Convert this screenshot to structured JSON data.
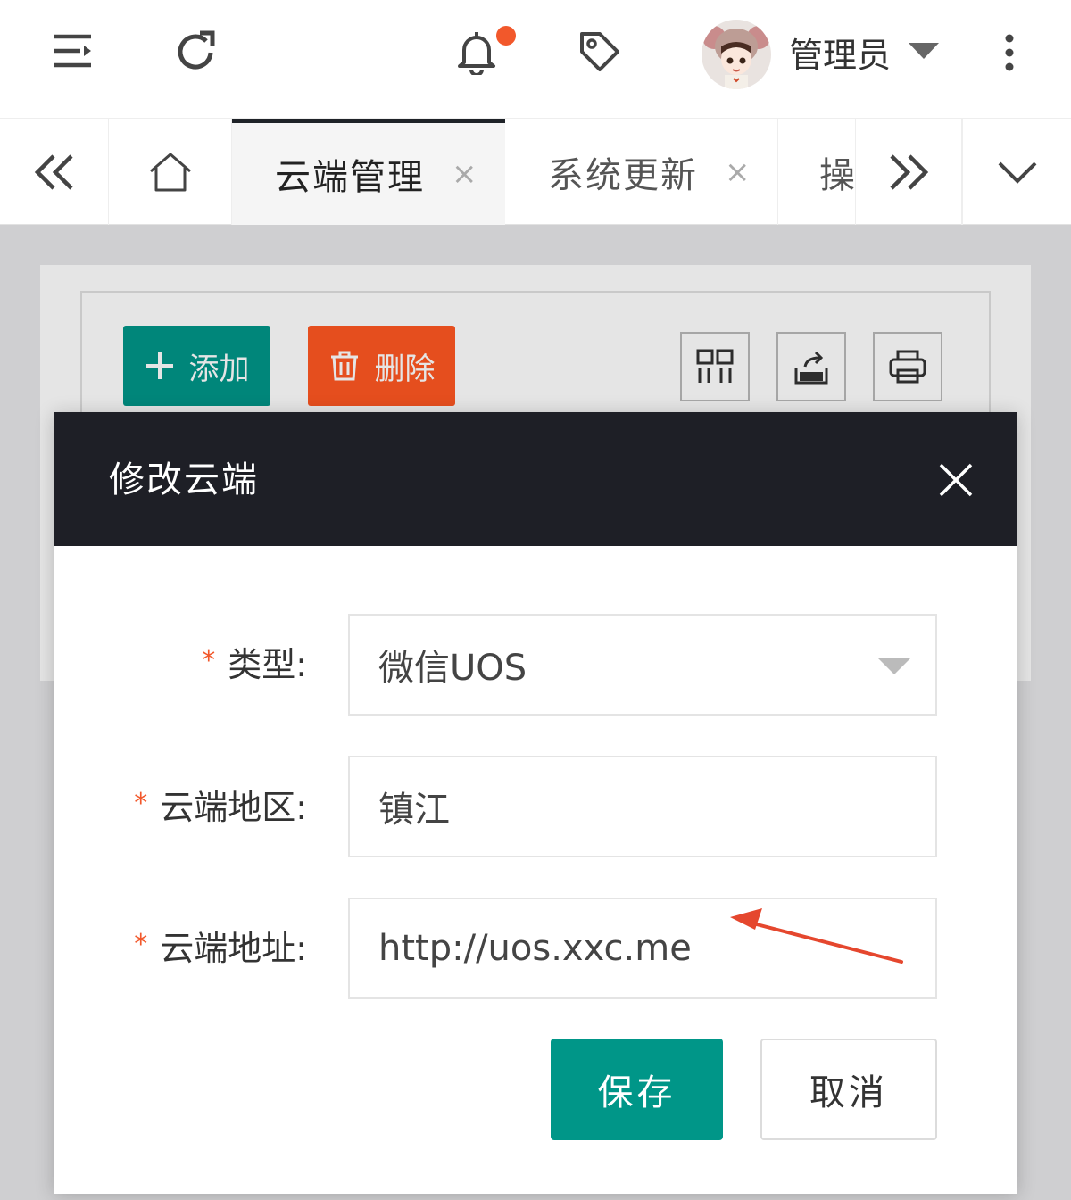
{
  "header": {
    "user_name": "管理员",
    "icons": {
      "menu": "menu-collapse-icon",
      "refresh": "refresh-icon",
      "bell": "bell-icon",
      "tag": "tag-icon",
      "more": "more-vertical-icon"
    },
    "notification_dot_color": "#f2582b"
  },
  "tabs": {
    "items": [
      {
        "label": "云端管理",
        "close": "×",
        "active": true
      },
      {
        "label": "系统更新",
        "close": "×",
        "active": false
      },
      {
        "label": "操",
        "close": "",
        "active": false
      }
    ]
  },
  "toolbar": {
    "add_label": "添加",
    "delete_label": "删除",
    "add_color": "#009688",
    "delete_color": "#ff5722"
  },
  "dialog": {
    "title": "修改云端",
    "required_mark": "*",
    "fields": [
      {
        "label": "类型:",
        "value": "微信UOS",
        "kind": "select"
      },
      {
        "label": "云端地区:",
        "value": "镇江",
        "kind": "text"
      },
      {
        "label": "云端地址:",
        "value": "http://uos.xxc.me",
        "kind": "text"
      }
    ],
    "save_label": "保存",
    "cancel_label": "取消"
  },
  "annotation": {
    "arrow_color": "#e5472e"
  }
}
